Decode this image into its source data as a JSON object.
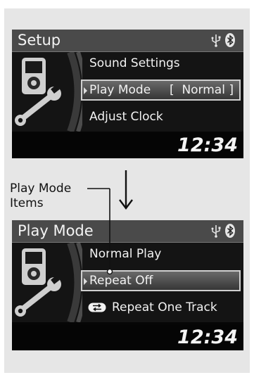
{
  "setup_screen": {
    "title": "Setup",
    "items": [
      {
        "label": "Sound Settings",
        "value": ""
      },
      {
        "label": "Play Mode",
        "value": "[  Normal ]"
      },
      {
        "label": "Adjust Clock",
        "value": ""
      }
    ],
    "selected_index": 1,
    "clock": "12:34"
  },
  "annotation": {
    "line1": "Play Mode",
    "line2": "Items"
  },
  "play_mode_screen": {
    "title": "Play Mode",
    "items": [
      {
        "label": "Normal Play"
      },
      {
        "label": "Repeat Off"
      },
      {
        "label": "Repeat One Track"
      }
    ],
    "selected_index": 1,
    "clock": "12:34"
  },
  "icons": {
    "status": [
      "usb-icon",
      "bluetooth-icon"
    ],
    "device": "media-player-icon",
    "tool": "wrench-icon",
    "repeat": "repeat-one-icon",
    "arrow": "arrow-down-icon"
  }
}
